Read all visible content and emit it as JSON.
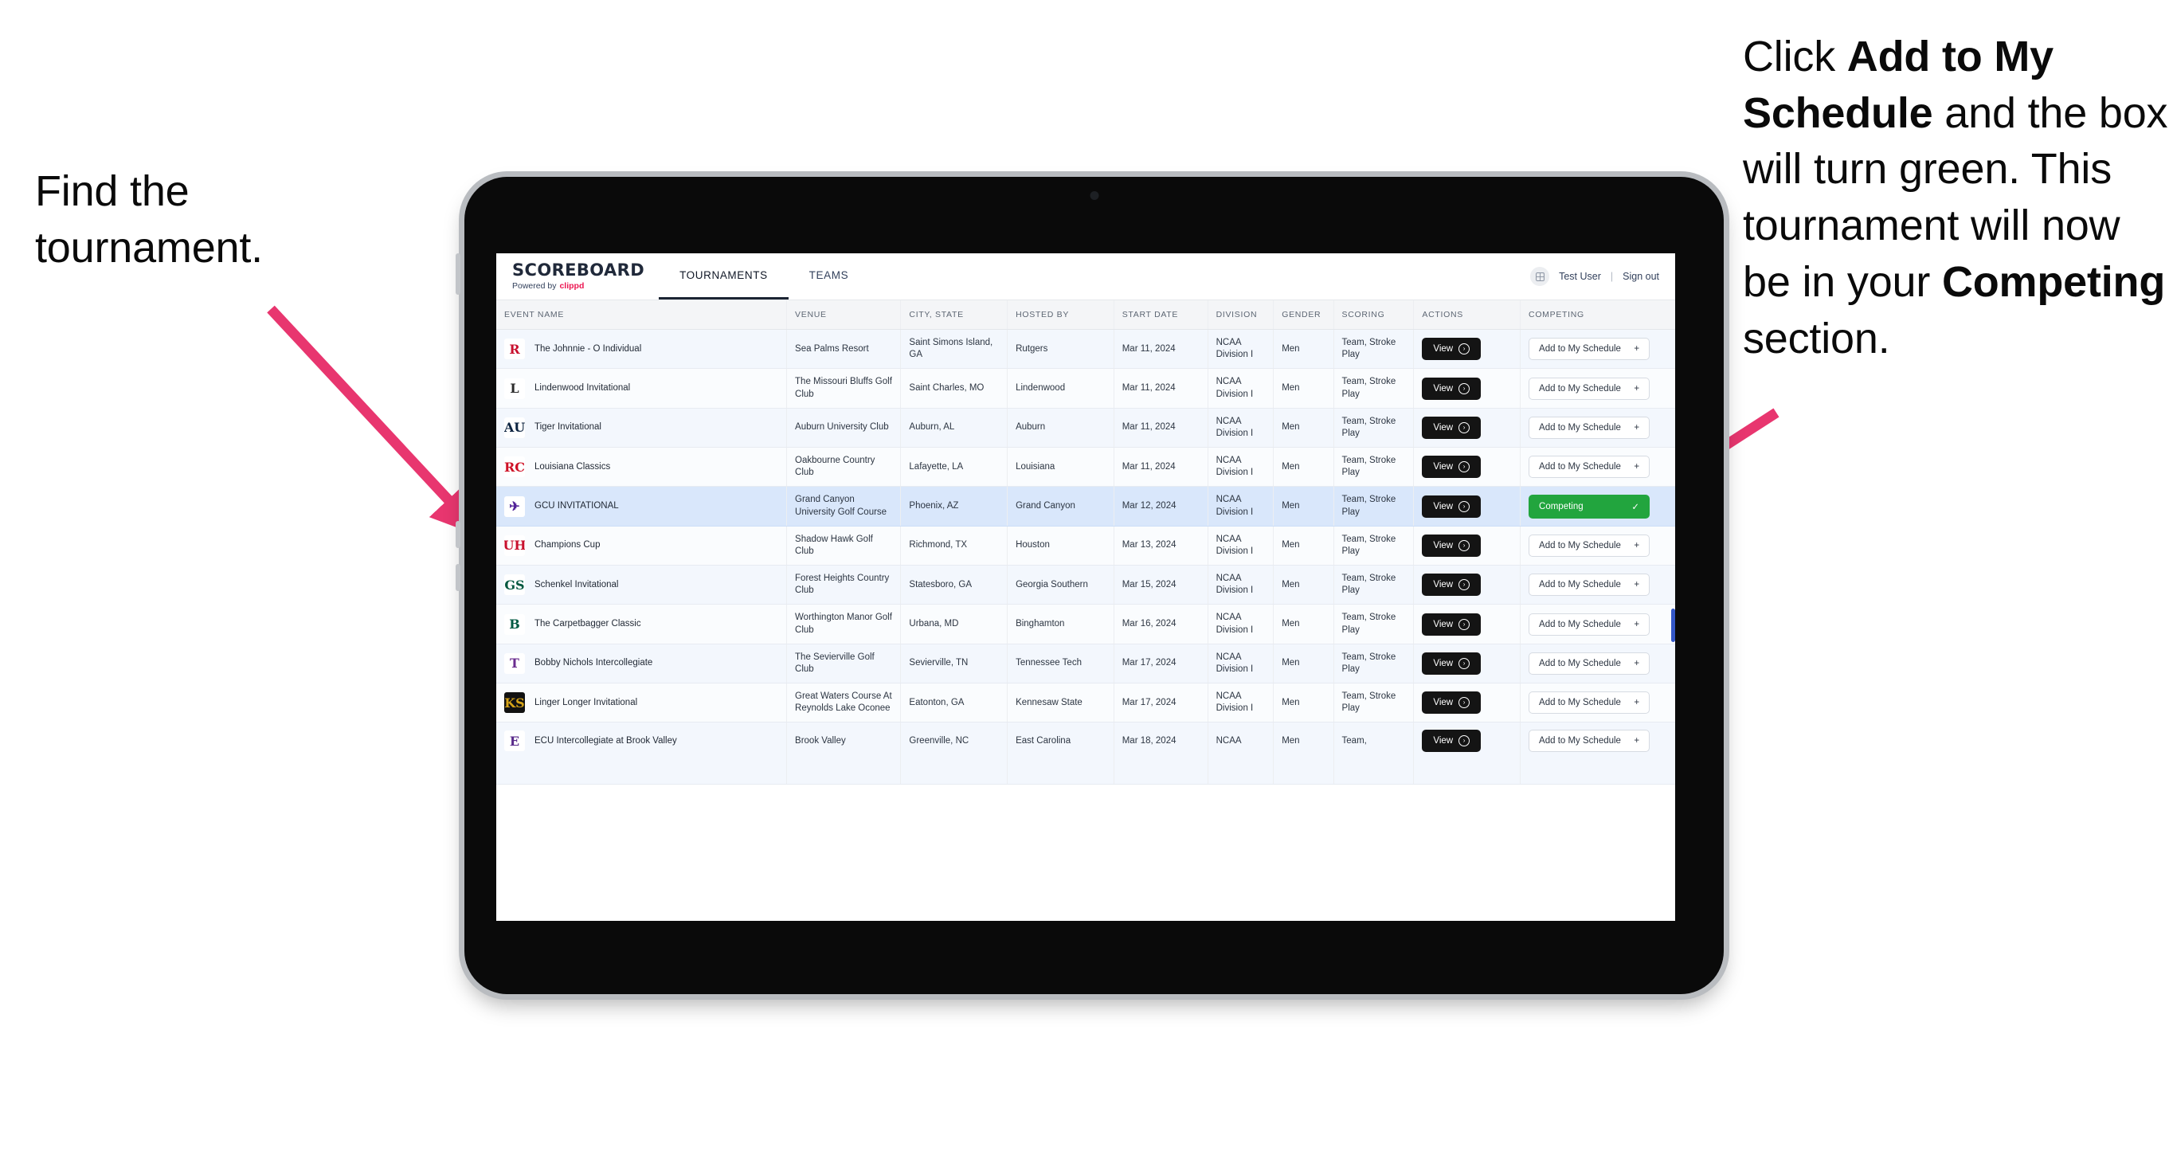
{
  "annotations": {
    "left": "Find the tournament.",
    "right_parts": [
      {
        "text": "Click ",
        "bold": false
      },
      {
        "text": "Add to My Schedule",
        "bold": true
      },
      {
        "text": " and the box will turn green. This tournament will now be in your ",
        "bold": false
      },
      {
        "text": "Competing",
        "bold": true
      },
      {
        "text": " section.",
        "bold": false
      }
    ],
    "arrow_color": "#e8366f"
  },
  "app": {
    "brand": {
      "title": "SCOREBOARD",
      "powered_prefix": "Powered by",
      "powered_brand": "clippd"
    },
    "tabs": [
      {
        "label": "TOURNAMENTS",
        "active": true
      },
      {
        "label": "TEAMS",
        "active": false
      }
    ],
    "header_right": {
      "avatar_icon": "user-grid-icon",
      "user": "Test User",
      "separator": "|",
      "signout": "Sign out"
    }
  },
  "table": {
    "columns": [
      "EVENT NAME",
      "VENUE",
      "CITY, STATE",
      "HOSTED BY",
      "START DATE",
      "DIVISION",
      "GENDER",
      "SCORING",
      "ACTIONS",
      "COMPETING"
    ],
    "view_label": "View",
    "add_label": "Add to My Schedule",
    "add_icon": "plus-icon",
    "competing_label": "Competing",
    "competing_icon": "check-icon",
    "rows": [
      {
        "event": "The Johnnie - O Individual",
        "venue": "Sea Palms Resort",
        "city": "Saint Simons Island, GA",
        "host": "Rutgers",
        "date": "Mar 11, 2024",
        "division": "NCAA Division I",
        "gender": "Men",
        "scoring": "Team, Stroke Play",
        "competing": false,
        "logo_text": "R",
        "logo_fg": "#c8102e",
        "logo_bg": "#ffffff"
      },
      {
        "event": "Lindenwood Invitational",
        "venue": "The Missouri Bluffs Golf Club",
        "city": "Saint Charles, MO",
        "host": "Lindenwood",
        "date": "Mar 11, 2024",
        "division": "NCAA Division I",
        "gender": "Men",
        "scoring": "Team, Stroke Play",
        "competing": false,
        "logo_text": "L",
        "logo_fg": "#2b2b2b",
        "logo_bg": "#ffffff"
      },
      {
        "event": "Tiger Invitational",
        "venue": "Auburn University Club",
        "city": "Auburn, AL",
        "host": "Auburn",
        "date": "Mar 11, 2024",
        "division": "NCAA Division I",
        "gender": "Men",
        "scoring": "Team, Stroke Play",
        "competing": false,
        "logo_text": "AU",
        "logo_fg": "#0c2340",
        "logo_bg": "#ffffff"
      },
      {
        "event": "Louisiana Classics",
        "venue": "Oakbourne Country Club",
        "city": "Lafayette, LA",
        "host": "Louisiana",
        "date": "Mar 11, 2024",
        "division": "NCAA Division I",
        "gender": "Men",
        "scoring": "Team, Stroke Play",
        "competing": false,
        "logo_text": "RC",
        "logo_fg": "#ce1126",
        "logo_bg": "#ffffff"
      },
      {
        "event": "GCU INVITATIONAL",
        "venue": "Grand Canyon University Golf Course",
        "city": "Phoenix, AZ",
        "host": "Grand Canyon",
        "date": "Mar 12, 2024",
        "division": "NCAA Division I",
        "gender": "Men",
        "scoring": "Team, Stroke Play",
        "competing": true,
        "logo_text": "✈",
        "logo_fg": "#522398",
        "logo_bg": "#ffffff"
      },
      {
        "event": "Champions Cup",
        "venue": "Shadow Hawk Golf Club",
        "city": "Richmond, TX",
        "host": "Houston",
        "date": "Mar 13, 2024",
        "division": "NCAA Division I",
        "gender": "Men",
        "scoring": "Team, Stroke Play",
        "competing": false,
        "logo_text": "UH",
        "logo_fg": "#c8102e",
        "logo_bg": "#ffffff"
      },
      {
        "event": "Schenkel Invitational",
        "venue": "Forest Heights Country Club",
        "city": "Statesboro, GA",
        "host": "Georgia Southern",
        "date": "Mar 15, 2024",
        "division": "NCAA Division I",
        "gender": "Men",
        "scoring": "Team, Stroke Play",
        "competing": false,
        "logo_text": "GS",
        "logo_fg": "#00573f",
        "logo_bg": "#ffffff"
      },
      {
        "event": "The Carpetbagger Classic",
        "venue": "Worthington Manor Golf Club",
        "city": "Urbana, MD",
        "host": "Binghamton",
        "date": "Mar 16, 2024",
        "division": "NCAA Division I",
        "gender": "Men",
        "scoring": "Team, Stroke Play",
        "competing": false,
        "logo_text": "B",
        "logo_fg": "#005a43",
        "logo_bg": "#ffffff"
      },
      {
        "event": "Bobby Nichols Intercollegiate",
        "venue": "The Sevierville Golf Club",
        "city": "Sevierville, TN",
        "host": "Tennessee Tech",
        "date": "Mar 17, 2024",
        "division": "NCAA Division I",
        "gender": "Men",
        "scoring": "Team, Stroke Play",
        "competing": false,
        "logo_text": "T",
        "logo_fg": "#6a2c8f",
        "logo_bg": "#ffffff"
      },
      {
        "event": "Linger Longer Invitational",
        "venue": "Great Waters Course At Reynolds Lake Oconee",
        "city": "Eatonton, GA",
        "host": "Kennesaw State",
        "date": "Mar 17, 2024",
        "division": "NCAA Division I",
        "gender": "Men",
        "scoring": "Team, Stroke Play",
        "competing": false,
        "logo_text": "KS",
        "logo_fg": "#d6a419",
        "logo_bg": "#111111"
      },
      {
        "event": "ECU Intercollegiate at Brook Valley",
        "venue": "Brook Valley",
        "city": "Greenville, NC",
        "host": "East Carolina",
        "date": "Mar 18, 2024",
        "division": "NCAA",
        "gender": "Men",
        "scoring": "Team,",
        "competing": false,
        "logo_text": "E",
        "logo_fg": "#592a8a",
        "logo_bg": "#ffffff",
        "cut": true
      }
    ]
  }
}
